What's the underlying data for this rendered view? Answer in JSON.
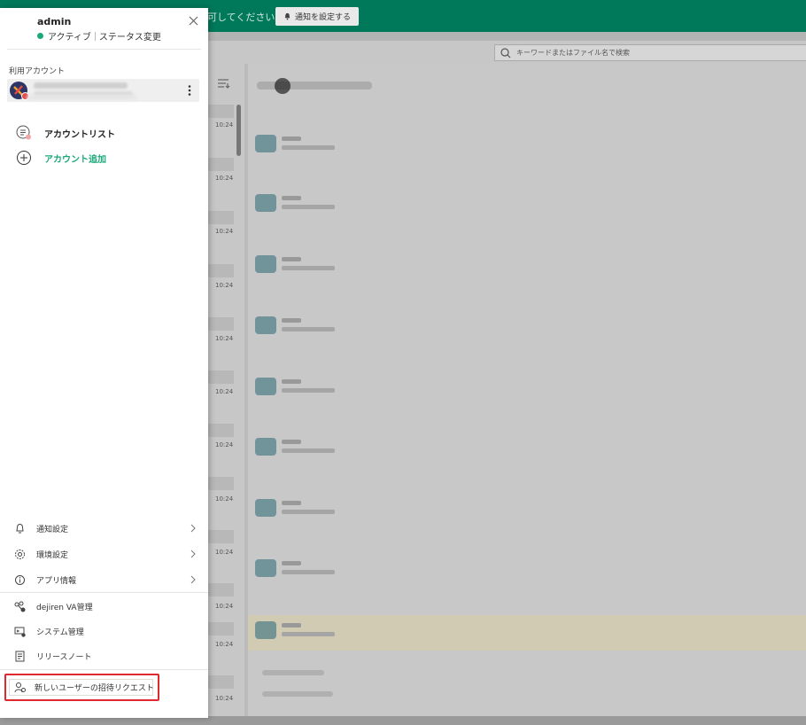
{
  "background": {
    "notice_text": "可してください。",
    "notify_button_label": "通知を設定する",
    "search_placeholder": "キーワードまたはファイル名で検索",
    "times": [
      "10:24",
      "10:24",
      "10:24",
      "10:24",
      "10:24",
      "10:24",
      "10:24",
      "10:24",
      "10:24",
      "10:24",
      "10:24",
      "10:24"
    ],
    "accent_color": "#00795a"
  },
  "drawer": {
    "user_name": "admin",
    "status_label": "アクティブ",
    "status_change_label": "ステータス変更",
    "status_color": "#1aa97a",
    "accounts_section_label": "利用アカウント",
    "account_list_label": "アカウントリスト",
    "add_account_label": "アカウント追加",
    "settings": [
      {
        "label": "通知設定",
        "icon": "bell-icon"
      },
      {
        "label": "環境設定",
        "icon": "gear-icon"
      },
      {
        "label": "アプリ情報",
        "icon": "info-icon"
      }
    ],
    "admin_items": [
      {
        "label": "dejiren VA管理",
        "icon": "va-manage-icon"
      },
      {
        "label": "システム管理",
        "icon": "system-manage-icon"
      },
      {
        "label": "リリースノート",
        "icon": "release-note-icon"
      }
    ],
    "invite_request_label": "新しいユーザーの招待リクエスト",
    "highlight_color": "#e0292e"
  }
}
